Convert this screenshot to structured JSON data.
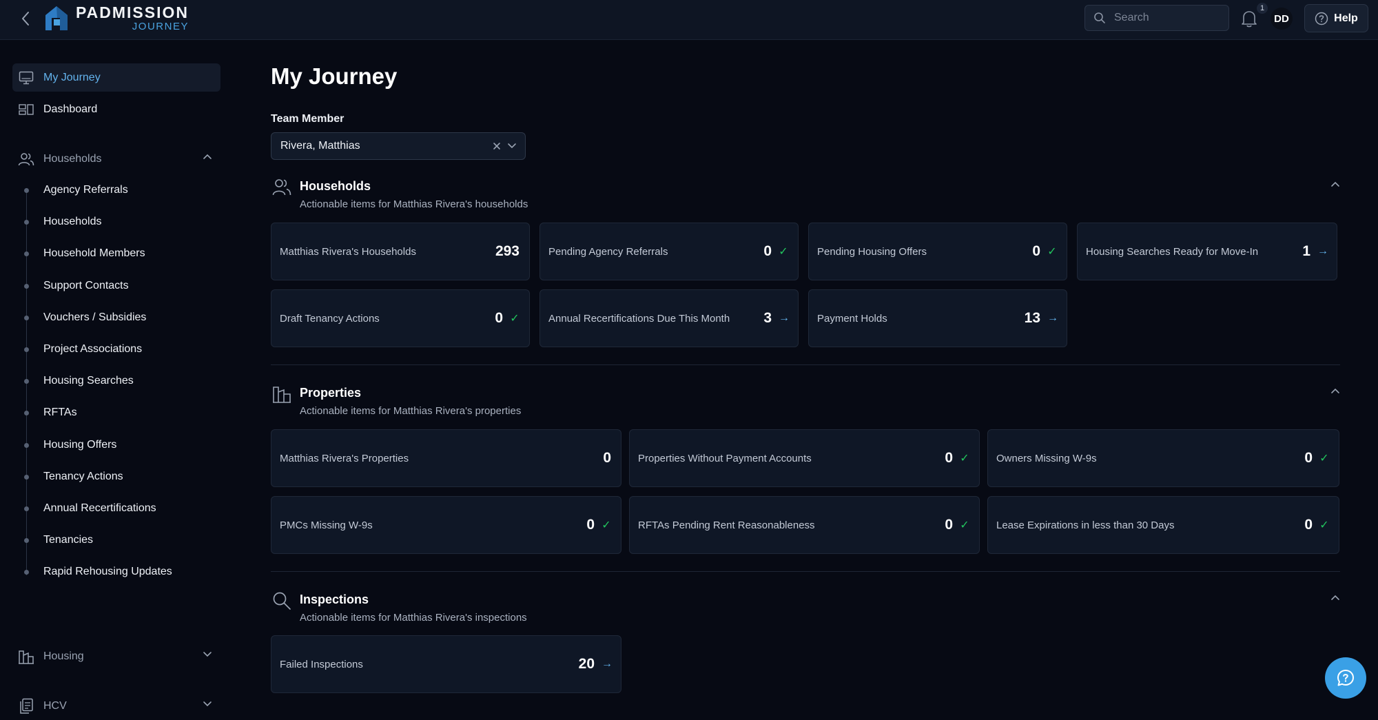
{
  "brand": {
    "name": "PADMISSION",
    "sub": "JOURNEY"
  },
  "header": {
    "search_placeholder": "Search",
    "notification_count": "1",
    "avatar_initials": "DD",
    "help_label": "Help"
  },
  "sidebar": {
    "top_items": [
      {
        "label": "My Journey",
        "active": true
      },
      {
        "label": "Dashboard",
        "active": false
      }
    ],
    "households_group": {
      "label": "Households",
      "expanded": true
    },
    "households_items": [
      "Agency Referrals",
      "Households",
      "Household Members",
      "Support Contacts",
      "Vouchers / Subsidies",
      "Project Associations",
      "Housing Searches",
      "RFTAs",
      "Housing Offers",
      "Tenancy Actions",
      "Annual Recertifications",
      "Tenancies",
      "Rapid Rehousing Updates"
    ],
    "housing_group": {
      "label": "Housing",
      "expanded": false
    },
    "hcv_group": {
      "label": "HCV",
      "expanded": false
    }
  },
  "main": {
    "title": "My Journey",
    "team_member_label": "Team Member",
    "team_member_value": "Rivera, Matthias",
    "sections": {
      "households": {
        "title": "Households",
        "subtitle": "Actionable items for Matthias Rivera's households",
        "cards": [
          {
            "label": "Matthias Rivera's Households",
            "value": "293",
            "indicator": ""
          },
          {
            "label": "Pending Agency Referrals",
            "value": "0",
            "indicator": "✓"
          },
          {
            "label": "Pending Housing Offers",
            "value": "0",
            "indicator": "✓"
          },
          {
            "label": "Housing Searches Ready for Move-In",
            "value": "1",
            "indicator": "→"
          },
          {
            "label": "Draft Tenancy Actions",
            "value": "0",
            "indicator": "✓"
          },
          {
            "label": "Annual Recertifications Due This Month",
            "value": "3",
            "indicator": "→"
          },
          {
            "label": "Payment Holds",
            "value": "13",
            "indicator": "→"
          }
        ]
      },
      "properties": {
        "title": "Properties",
        "subtitle": "Actionable items for Matthias Rivera's properties",
        "cards": [
          {
            "label": "Matthias Rivera's Properties",
            "value": "0",
            "indicator": ""
          },
          {
            "label": "Properties Without Payment Accounts",
            "value": "0",
            "indicator": "✓"
          },
          {
            "label": "Owners Missing W-9s",
            "value": "0",
            "indicator": "✓"
          },
          {
            "label": "PMCs Missing W-9s",
            "value": "0",
            "indicator": "✓"
          },
          {
            "label": "RFTAs Pending Rent Reasonableness",
            "value": "0",
            "indicator": "✓"
          },
          {
            "label": "Lease Expirations in less than 30 Days",
            "value": "0",
            "indicator": "✓"
          }
        ]
      },
      "inspections": {
        "title": "Inspections",
        "subtitle": "Actionable items for Matthias Rivera's inspections",
        "cards": [
          {
            "label": "Failed Inspections",
            "value": "20",
            "indicator": "→"
          }
        ]
      }
    }
  }
}
